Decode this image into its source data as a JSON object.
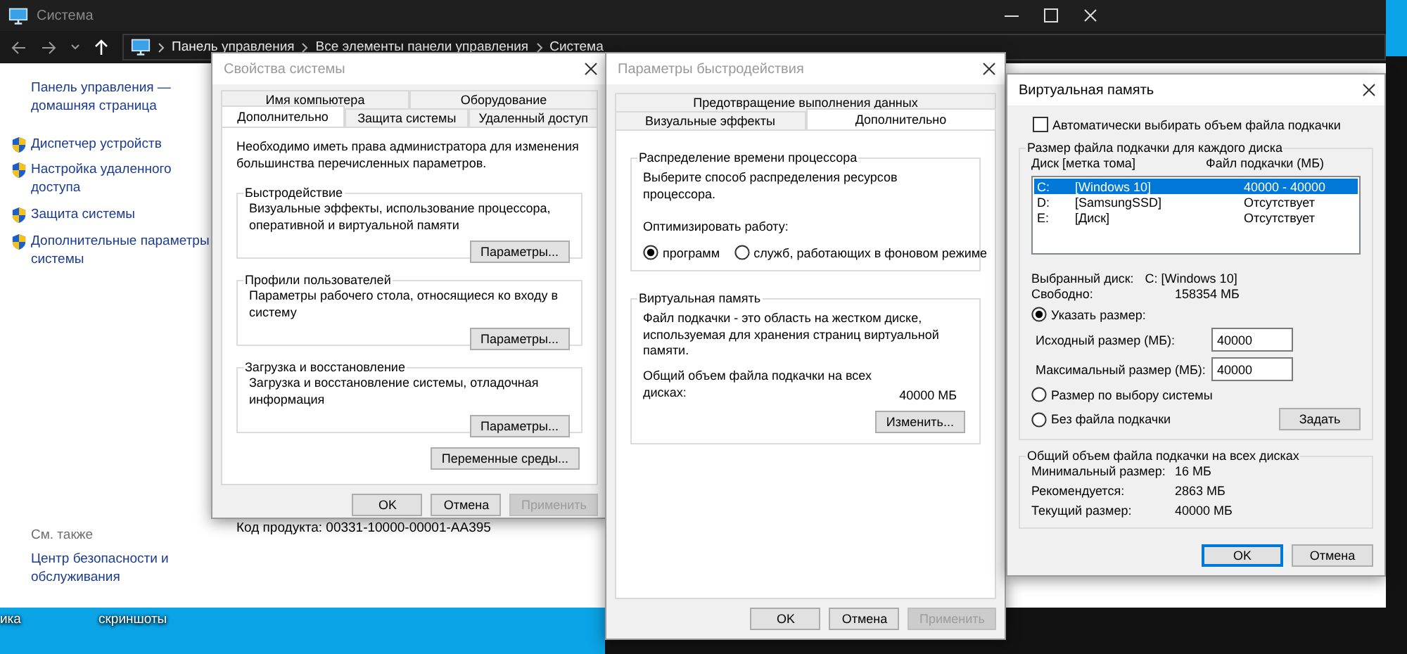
{
  "desktop": {
    "icon_labels": [
      "ика",
      "скриншоты"
    ]
  },
  "main_window": {
    "title": "Система",
    "active": false,
    "breadcrumb": [
      "Панель управления",
      "Все элементы панели управления",
      "Система"
    ],
    "sidebar": {
      "home_link": "Панель управления — домашняя страница",
      "items": [
        {
          "label": "Диспетчер устройств"
        },
        {
          "label": "Настройка удаленного доступа"
        },
        {
          "label": "Защита системы"
        },
        {
          "label": "Дополнительные параметры системы"
        }
      ],
      "see_also_title": "См. также",
      "see_also": [
        "Центр безопасности и обслуживания"
      ]
    },
    "product_code": "Код продукта:  00331-10000-00001-AA395"
  },
  "system_properties": {
    "title": "Свойства системы",
    "active": false,
    "tab_rows": [
      [
        {
          "label": "Имя компьютера",
          "selected": false
        },
        {
          "label": "Оборудование",
          "selected": false
        }
      ],
      [
        {
          "label": "Дополнительно",
          "selected": true
        },
        {
          "label": "Защита системы",
          "selected": false
        },
        {
          "label": "Удаленный доступ",
          "selected": false
        }
      ]
    ],
    "intro": "Необходимо иметь права администратора для изменения большинства перечисленных параметров.",
    "groups": [
      {
        "title": "Быстродействие",
        "description": "Визуальные эффекты, использование процессора, оперативной и виртуальной памяти",
        "button": "Параметры..."
      },
      {
        "title": "Профили пользователей",
        "description": "Параметры рабочего стола, относящиеся ко входу в систему",
        "button": "Параметры..."
      },
      {
        "title": "Загрузка и восстановление",
        "description": "Загрузка и восстановление системы, отладочная информация",
        "button": "Параметры..."
      }
    ],
    "env_button": "Переменные среды...",
    "buttons": [
      {
        "label": "OK",
        "disabled": false
      },
      {
        "label": "Отмена",
        "disabled": false
      },
      {
        "label": "Применить",
        "disabled": true
      }
    ]
  },
  "performance_options": {
    "title": "Параметры быстродействия",
    "active": false,
    "tab_rows": [
      [
        {
          "label": "Предотвращение выполнения данных",
          "selected": false
        }
      ],
      [
        {
          "label": "Визуальные эффекты",
          "selected": false
        },
        {
          "label": "Дополнительно",
          "selected": true
        }
      ]
    ],
    "cpu_group": {
      "title": "Распределение времени процессора",
      "prompt": "Выберите способ распределения ресурсов процессора.",
      "optimize_label": "Оптимизировать работу:",
      "options": [
        {
          "label": "программ",
          "selected": true
        },
        {
          "label": "служб, работающих в фоновом режиме",
          "selected": false
        }
      ]
    },
    "vm_group": {
      "title": "Виртуальная память",
      "description": "Файл подкачки - это область на жестком диске, используемая для хранения страниц виртуальной памяти.",
      "total_label": "Общий объем файла подкачки на всех дисках:",
      "total_value": "40000 МБ",
      "button": "Изменить..."
    },
    "buttons": [
      {
        "label": "OK",
        "disabled": false
      },
      {
        "label": "Отмена",
        "disabled": false
      },
      {
        "label": "Применить",
        "disabled": true
      }
    ]
  },
  "virtual_memory": {
    "title": "Виртуальная память",
    "active": true,
    "auto_checkbox": {
      "label": "Автоматически выбирать объем файла подкачки",
      "checked": false
    },
    "per_disk": {
      "title": "Размер файла подкачки для каждого диска",
      "columns": [
        "Диск [метка тома]",
        "Файл подкачки (МБ)"
      ],
      "drives": [
        {
          "drive": "C:",
          "label": "[Windows 10]",
          "size": "40000 - 40000",
          "selected": true
        },
        {
          "drive": "D:",
          "label": "[SamsungSSD]",
          "size": "Отсутствует",
          "selected": false
        },
        {
          "drive": "E:",
          "label": "[Диск]",
          "size": "Отсутствует",
          "selected": false
        }
      ],
      "selected_drive_label": "Выбранный диск:",
      "selected_drive_value": "C:  [Windows 10]",
      "free_label": "Свободно:",
      "free_value": "158354 МБ",
      "size_modes": [
        {
          "kind": "custom",
          "label": "Указать размер:",
          "selected": true
        },
        {
          "kind": "system",
          "label": "Размер по выбору системы",
          "selected": false
        },
        {
          "kind": "none",
          "label": "Без файла подкачки",
          "selected": false
        }
      ],
      "initial_size": {
        "label": "Исходный размер (МБ):",
        "value": "40000"
      },
      "max_size": {
        "label": "Максимальный размер (МБ):",
        "value": "40000"
      },
      "set_button": "Задать"
    },
    "totals": {
      "title": "Общий объем файла подкачки на всех дисках",
      "rows": [
        {
          "label": "Минимальный размер:",
          "value": "16 МБ"
        },
        {
          "label": "Рекомендуется:",
          "value": "2863 МБ"
        },
        {
          "label": "Текущий размер:",
          "value": "40000 МБ"
        }
      ]
    },
    "buttons": [
      {
        "label": "OK",
        "default": true
      },
      {
        "label": "Отмена",
        "default": false
      }
    ]
  }
}
